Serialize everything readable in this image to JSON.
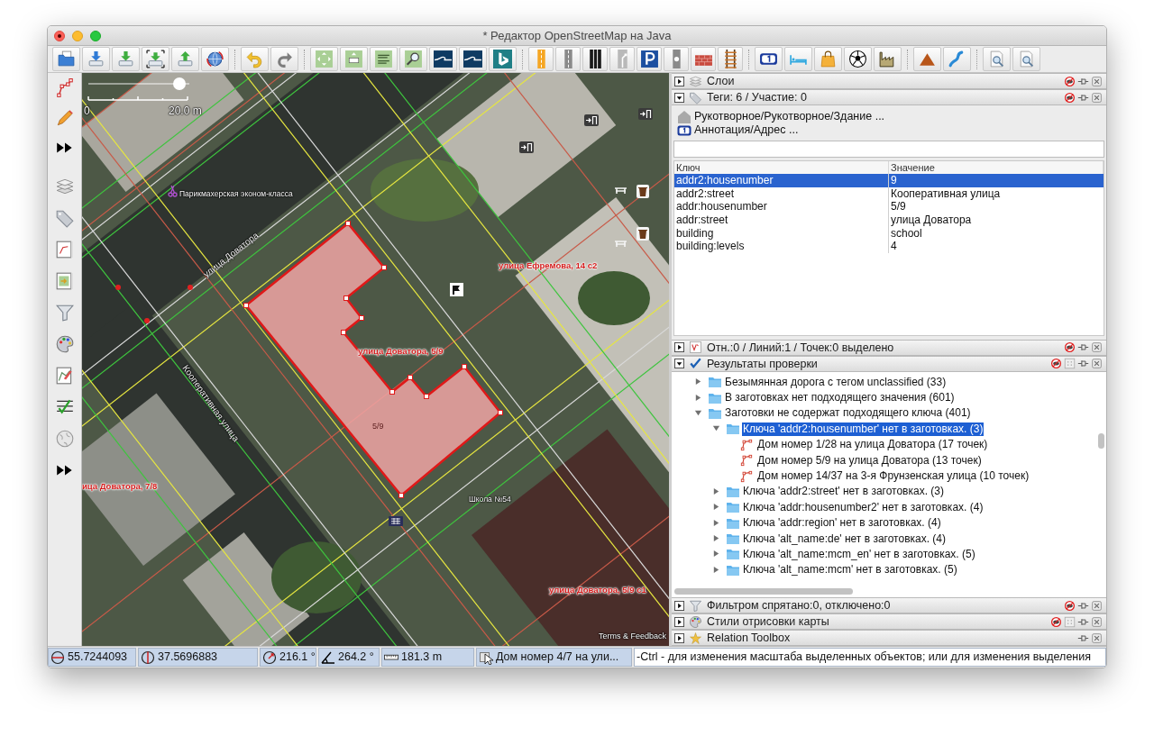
{
  "window": {
    "title": "* Редактор OpenStreetMap на Java"
  },
  "map": {
    "zoom_slider": {
      "level": 0.9
    },
    "scale": {
      "start": "0",
      "end": "20.0 m"
    },
    "labels": [
      {
        "kind": "poi",
        "text": "Парикмахерская эконом-класса"
      },
      {
        "kind": "road",
        "text": "улица Доватора"
      },
      {
        "kind": "road",
        "text": "Кооперативная улица"
      },
      {
        "kind": "address",
        "text": "улица Ефремова, 14 с2"
      },
      {
        "kind": "address",
        "text": "улица Доватора, 5/9"
      },
      {
        "kind": "housenumber",
        "text": "5/9"
      },
      {
        "kind": "poi",
        "text": "Школа №54"
      },
      {
        "kind": "address",
        "text": "ица Доватора, 7/8"
      },
      {
        "kind": "address",
        "text": "улица Доватора, 5/9 с1"
      }
    ],
    "attribution": "Terms & Feedback"
  },
  "panels": [
    {
      "kind": "layers",
      "title": "Слои",
      "expanded": false
    },
    {
      "kind": "tags",
      "title": "Теги: 6 / Участие: 0",
      "expanded": true,
      "presets": [
        {
          "kind": "building",
          "label": "Рукотворное/Рукотворное/Здание ..."
        },
        {
          "kind": "address",
          "label": "Аннотация/Адрес ..."
        }
      ],
      "table": {
        "columns": [
          "Ключ",
          "Значение"
        ],
        "rows": [
          {
            "key": "addr2:housenumber",
            "value": "9",
            "selected": true
          },
          {
            "key": "addr2:street",
            "value": "Кооперативная улица",
            "selected": false
          },
          {
            "key": "addr:housenumber",
            "value": "5/9",
            "selected": false
          },
          {
            "key": "addr:street",
            "value": "улица Доватора",
            "selected": false
          },
          {
            "key": "building",
            "value": "school",
            "selected": false
          },
          {
            "key": "building:levels",
            "value": "4",
            "selected": false
          }
        ]
      }
    },
    {
      "kind": "selection",
      "title": "Отн.:0 / Линий:1 / Точек:0 выделено",
      "expanded": false
    },
    {
      "kind": "validator",
      "title": "Результаты проверки",
      "expanded": true,
      "tree": [
        {
          "kind": "group",
          "label": "Безымянная дорога с тегом unclassified (33)",
          "expanded": false,
          "selected": false
        },
        {
          "kind": "group",
          "label": "В заготовках нет подходящего значения (601)",
          "expanded": false,
          "selected": false
        },
        {
          "kind": "group",
          "label": "Заготовки не содержат подходящего ключа (401)",
          "expanded": true,
          "selected": false,
          "children": [
            {
              "kind": "group",
              "label": "Ключа 'addr2:housenumber' нет в заготовках. (3)",
              "expanded": true,
              "selected": true,
              "children": [
                {
                  "kind": "way",
                  "label": "Дом номер 1/28 на улица Доватора (17 точек)",
                  "selected": false
                },
                {
                  "kind": "way",
                  "label": "Дом номер 5/9 на улица Доватора (13 точек)",
                  "selected": false
                },
                {
                  "kind": "way",
                  "label": "Дом номер 14/37 на 3-я Фрунзенская улица (10 точек)",
                  "selected": false
                }
              ]
            },
            {
              "kind": "group",
              "label": "Ключа 'addr2:street' нет в заготовках. (3)",
              "expanded": false,
              "selected": false
            },
            {
              "kind": "group",
              "label": "Ключа 'addr:housenumber2' нет в заготовках. (4)",
              "expanded": false,
              "selected": false
            },
            {
              "kind": "group",
              "label": "Ключа 'addr:region' нет в заготовках. (4)",
              "expanded": false,
              "selected": false
            },
            {
              "kind": "group",
              "label": "Ключа 'alt_name:de' нет в заготовках. (4)",
              "expanded": false,
              "selected": false
            },
            {
              "kind": "group",
              "label": "Ключа 'alt_name:mcm_en' нет в заготовках. (5)",
              "expanded": false,
              "selected": false
            },
            {
              "kind": "group",
              "label": "Ключа 'alt_name:mcm' нет в заготовках. (5)",
              "expanded": false,
              "selected": false
            }
          ]
        }
      ]
    },
    {
      "kind": "filter",
      "title": "Фильтром спрятано:0, отключено:0",
      "expanded": false
    },
    {
      "kind": "styles",
      "title": "Стили отрисовки карты",
      "expanded": false
    },
    {
      "kind": "relations",
      "title": "Relation Toolbox",
      "expanded": false
    }
  ],
  "status_bar": [
    {
      "kind": "lat",
      "text": "55.7244093"
    },
    {
      "kind": "lon",
      "text": "37.5696883"
    },
    {
      "kind": "heading",
      "text": "216.1 °"
    },
    {
      "kind": "angle",
      "text": "264.2 °"
    },
    {
      "kind": "distance",
      "text": "181.3 m"
    },
    {
      "kind": "name",
      "text": "Дом номер 4/7 на ули..."
    },
    {
      "kind": "help",
      "text": "-Ctrl - для изменения масштаба выделенных объектов; или для изменения выделения"
    }
  ]
}
